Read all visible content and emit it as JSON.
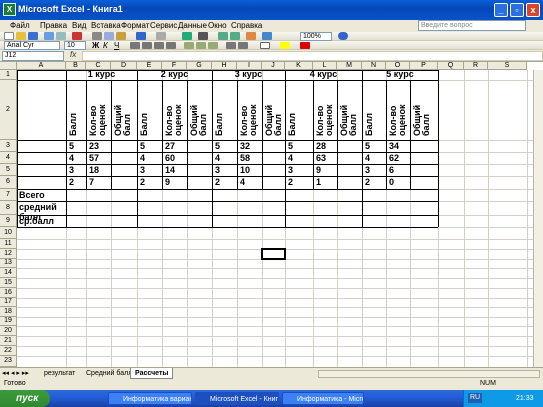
{
  "window": {
    "title": "Microsoft Excel - Книга1",
    "min": "_",
    "max": "▫",
    "close": "x"
  },
  "menu": {
    "items": [
      "Файл",
      "Правка",
      "Вид",
      "Вставка",
      "Формат",
      "Сервис",
      "Данные",
      "Окно",
      "Справка"
    ],
    "help_placeholder": "Введите вопрос"
  },
  "toolbar": {
    "font": "Arial Cyr",
    "size": "10",
    "zoom": "100%",
    "bold": "Ж",
    "italic": "К",
    "underline": "Ч"
  },
  "formula_bar": {
    "cell_ref": "J12",
    "fx": "fx",
    "value": ""
  },
  "columns": [
    "A",
    "B",
    "C",
    "D",
    "E",
    "F",
    "G",
    "H",
    "I",
    "J",
    "K",
    "L",
    "M",
    "N",
    "O",
    "P",
    "Q",
    "R",
    "S"
  ],
  "rows": [
    "1",
    "2",
    "3",
    "4",
    "5",
    "6",
    "7",
    "8",
    "9",
    "10",
    "11",
    "12",
    "13",
    "14",
    "15",
    "16",
    "17",
    "18",
    "19",
    "20",
    "21",
    "22",
    "23"
  ],
  "courses": [
    {
      "title": "1 курс",
      "balls": [
        "5",
        "4",
        "3",
        "2"
      ],
      "counts": [
        "23",
        "57",
        "18",
        "7"
      ]
    },
    {
      "title": "2 курс",
      "balls": [
        "5",
        "4",
        "3",
        "2"
      ],
      "counts": [
        "27",
        "60",
        "14",
        "9"
      ]
    },
    {
      "title": "3 курс",
      "balls": [
        "5",
        "4",
        "3",
        "2"
      ],
      "counts": [
        "32",
        "58",
        "10",
        "4"
      ]
    },
    {
      "title": "4 курс",
      "balls": [
        "5",
        "4",
        "3",
        "2"
      ],
      "counts": [
        "28",
        "63",
        "9",
        "1"
      ]
    },
    {
      "title": "5 курс",
      "balls": [
        "5",
        "4",
        "3",
        "2"
      ],
      "counts": [
        "34",
        "62",
        "6",
        "0"
      ]
    }
  ],
  "subheaders": {
    "ball": "Балл",
    "count_line1": "Кол-во",
    "count_line2": "оценок",
    "total_line1": "Общий",
    "total_line2": "балл"
  },
  "row_labels": {
    "total": "Всего",
    "avg_line1": "средний",
    "avg_line2": "балл",
    "avg_short": "ср.балл"
  },
  "sheets": {
    "tabs": [
      "результат",
      "Средний балл",
      "Рассчеты"
    ],
    "active": "Рассчеты"
  },
  "status": {
    "left": "Готово",
    "right": "NUM"
  },
  "taskbar": {
    "start": "пуск",
    "tasks": [
      "Информатика вариант...",
      "Microsoft Excel - Книга1",
      "Информатика - Micros..."
    ],
    "lang": "RU",
    "time": "21:33"
  }
}
